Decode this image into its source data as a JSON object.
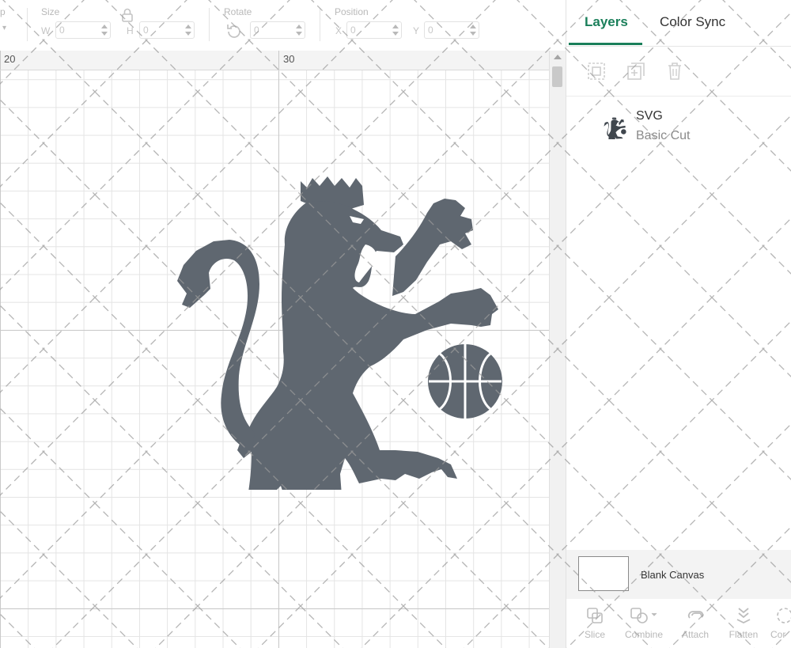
{
  "toolbar": {
    "operation_partial": "p",
    "size_label": "Size",
    "w_prefix": "W",
    "w_value": "0",
    "h_prefix": "H",
    "h_value": "0",
    "rotate_label": "Rotate",
    "rotate_value": "0",
    "position_label": "Position",
    "x_prefix": "X",
    "x_value": "0",
    "y_prefix": "Y",
    "y_value": "0"
  },
  "ruler": {
    "marks": [
      "20",
      "30"
    ]
  },
  "panel": {
    "tabs": [
      {
        "label": "Layers",
        "active": true
      },
      {
        "label": "Color Sync",
        "active": false
      }
    ],
    "layer": {
      "name": "SVG",
      "type": "Basic Cut",
      "icon": "lion-thumbnail-icon"
    },
    "blank_canvas_label": "Blank Canvas",
    "tools": [
      {
        "label": "Slice",
        "icon": "slice-icon"
      },
      {
        "label": "Combine",
        "icon": "combine-icon"
      },
      {
        "label": "Attach",
        "icon": "attach-icon"
      },
      {
        "label": "Flatten",
        "icon": "flatten-icon"
      },
      {
        "label": "Cor",
        "icon": "contour-icon"
      }
    ]
  },
  "colors": {
    "accent": "#1a7f5a",
    "design": "#5f6770"
  }
}
